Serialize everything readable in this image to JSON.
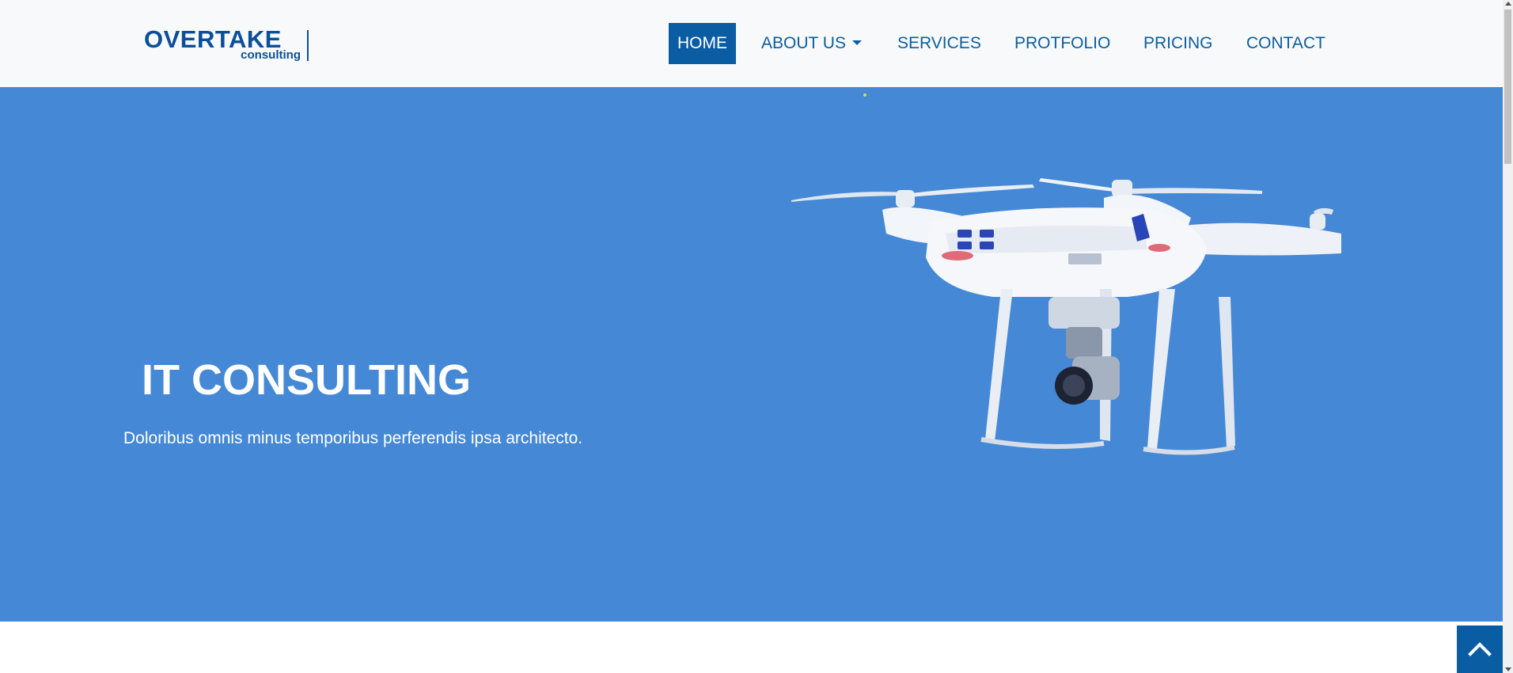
{
  "logo": {
    "main": "OVERTAKE",
    "sub": "consulting"
  },
  "nav": {
    "items": [
      {
        "label": "HOME",
        "active": true
      },
      {
        "label": "ABOUT US",
        "dropdown": true
      },
      {
        "label": "SERVICES"
      },
      {
        "label": "PROTFOLIO"
      },
      {
        "label": "PRICING"
      },
      {
        "label": "CONTACT"
      }
    ]
  },
  "hero": {
    "title": "IT CONSULTING",
    "subtitle": "Doloribus omnis minus temporibus perferendis ipsa architecto.",
    "image_icon": "drone-image"
  },
  "back_to_top": {
    "icon": "chevron-up-icon"
  },
  "colors": {
    "brand": "#0b4f99",
    "nav_active_bg": "#0a5ca3",
    "hero_bg": "#4588d6",
    "navbar_bg": "#f8f9fa"
  }
}
